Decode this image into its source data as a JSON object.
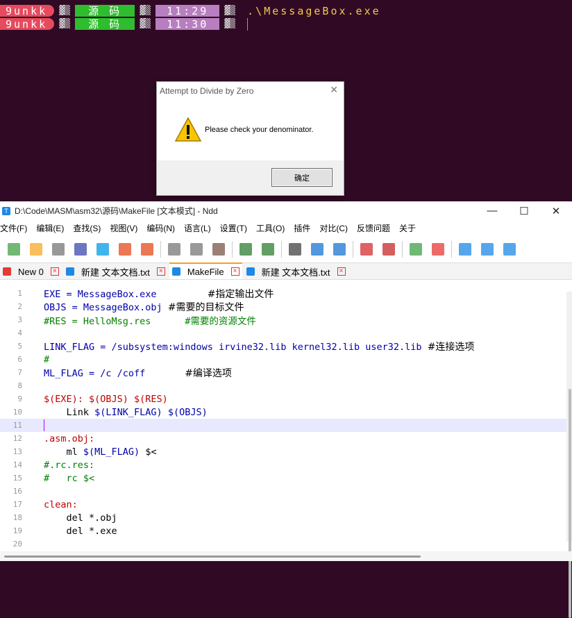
{
  "terminal": {
    "lines": [
      {
        "user": "9unkk",
        "noise": "▓▒",
        "dir": "源 码",
        "time": "11:29",
        "cmd": ".\\MessageBox.exe"
      },
      {
        "user": "9unkk",
        "noise": "▓▒",
        "dir": "源 码",
        "time": "11:30",
        "cmd": ""
      }
    ]
  },
  "dialog": {
    "title": "Attempt to Divide by Zero",
    "message": "Please check your denominator.",
    "ok_label": "确定",
    "close_glyph": "✕"
  },
  "window": {
    "title": "D:\\Code\\MASM\\asm32\\源码\\MakeFile [文本模式] - Ndd",
    "minimize": "—",
    "maximize": "☐",
    "close": "✕"
  },
  "menu": [
    "文件(F)",
    "编辑(E)",
    "查找(S)",
    "视图(V)",
    "编码(N)",
    "语言(L)",
    "设置(T)",
    "工具(O)",
    "插件",
    "对比(C)",
    "反馈问题",
    "关于"
  ],
  "toolbar": {
    "icons": [
      "new-file-icon",
      "open-file-icon",
      "save-icon",
      "save-all-icon",
      "reload-icon",
      "close-file-icon",
      "close-all-icon",
      "cut-icon",
      "copy-icon",
      "paste-icon",
      "undo-icon",
      "redo-icon",
      "find-icon",
      "replace-icon",
      "bookmark-icon",
      "mark-icon",
      "clear-mark-icon",
      "zoom-in-icon",
      "zoom-out-icon",
      "wrap-icon",
      "show-symbols-icon",
      "indent-guide-icon"
    ]
  },
  "tabs": [
    {
      "label": "New 0",
      "color": "#e53935",
      "active": false
    },
    {
      "label": "新建 文本文档.txt",
      "color": "#1e88e5",
      "active": false
    },
    {
      "label": "MakeFile",
      "color": "#1e88e5",
      "active": true
    },
    {
      "label": "新建 文本文档.txt",
      "color": "#1e88e5",
      "active": false
    }
  ],
  "code": [
    {
      "n": "1",
      "parts": [
        [
          "c-def",
          "EXE = MessageBox.exe         "
        ],
        [
          "cn",
          "#指定输出文件"
        ]
      ]
    },
    {
      "n": "2",
      "parts": [
        [
          "c-def",
          "OBJS = MessageBox.obj "
        ],
        [
          "cn",
          "#需要的目标文件"
        ]
      ]
    },
    {
      "n": "3",
      "parts": [
        [
          "c-com",
          "#RES = HelloMsg.res      #需要的资源文件"
        ]
      ]
    },
    {
      "n": "4",
      "parts": []
    },
    {
      "n": "5",
      "parts": [
        [
          "c-def",
          "LINK_FLAG = /subsystem:windows irvine32.lib kernel32.lib user32.lib "
        ],
        [
          "cn",
          "#连接选项"
        ]
      ]
    },
    {
      "n": "6",
      "parts": [
        [
          "c-com",
          "#"
        ]
      ]
    },
    {
      "n": "7",
      "parts": [
        [
          "c-def",
          "ML_FLAG = /c /coff       "
        ],
        [
          "cn",
          "#编译选项"
        ]
      ]
    },
    {
      "n": "8",
      "parts": []
    },
    {
      "n": "9",
      "parts": [
        [
          "c-tgt",
          "$(EXE): $(OBJS) $(RES)"
        ]
      ]
    },
    {
      "n": "10",
      "parts": [
        [
          "c-plain",
          "    Link "
        ],
        [
          "c-def",
          "$(LINK_FLAG) $(OBJS)"
        ]
      ]
    },
    {
      "n": "11",
      "parts": [],
      "current": true
    },
    {
      "n": "12",
      "parts": [
        [
          "c-tgt",
          ".asm.obj:"
        ]
      ]
    },
    {
      "n": "13",
      "parts": [
        [
          "c-plain",
          "    ml "
        ],
        [
          "c-def",
          "$(ML_FLAG)"
        ],
        [
          "c-plain",
          " $<"
        ]
      ]
    },
    {
      "n": "14",
      "parts": [
        [
          "c-com",
          "#.rc.res:"
        ]
      ]
    },
    {
      "n": "15",
      "parts": [
        [
          "c-com",
          "#   rc $<"
        ]
      ]
    },
    {
      "n": "16",
      "parts": []
    },
    {
      "n": "17",
      "parts": [
        [
          "c-tgt",
          "clean:"
        ]
      ]
    },
    {
      "n": "18",
      "parts": [
        [
          "c-plain",
          "    del *.obj"
        ]
      ]
    },
    {
      "n": "19",
      "parts": [
        [
          "c-plain",
          "    del *.exe"
        ]
      ]
    },
    {
      "n": "20",
      "parts": []
    }
  ]
}
